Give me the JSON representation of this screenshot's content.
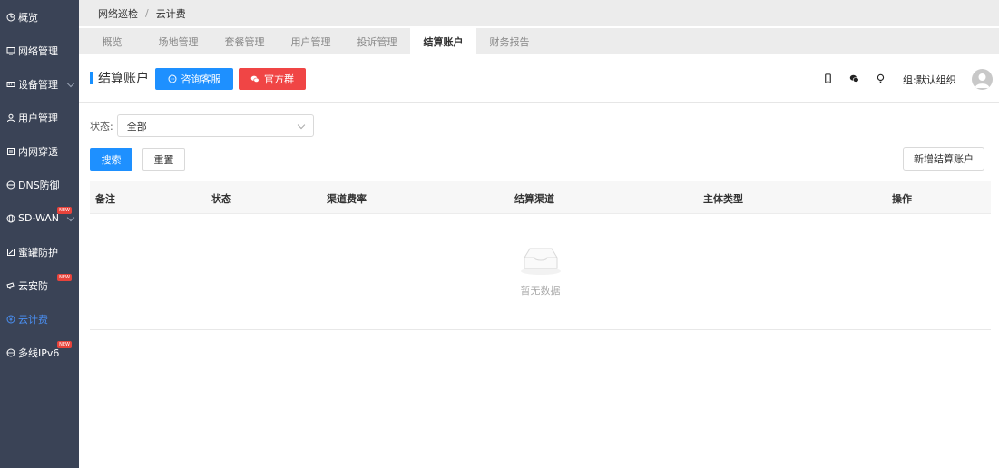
{
  "sidebar": {
    "items": [
      {
        "label": "概览",
        "icon": "dashboard-icon"
      },
      {
        "label": "网络管理",
        "icon": "monitor-icon"
      },
      {
        "label": "设备管理",
        "icon": "device-icon",
        "expandable": true
      },
      {
        "label": "用户管理",
        "icon": "user-icon"
      },
      {
        "label": "内网穿透",
        "icon": "tunnel-icon"
      },
      {
        "label": "DNS防御",
        "icon": "shield-icon"
      },
      {
        "label": "SD-WAN",
        "icon": "globe-icon",
        "expandable": true,
        "badge": "NEW"
      },
      {
        "label": "蜜罐防护",
        "icon": "honeypot-icon"
      },
      {
        "label": "云安防",
        "icon": "camera-icon",
        "badge": "NEW"
      },
      {
        "label": "云计费",
        "icon": "billing-icon",
        "active": true
      },
      {
        "label": "多线IPv6",
        "icon": "globe-icon",
        "badge": "NEW"
      }
    ]
  },
  "breadcrumb": {
    "items": [
      "网络巡检",
      "云计费"
    ],
    "separator": "/"
  },
  "tabs": {
    "items": [
      "概览",
      "场地管理",
      "套餐管理",
      "用户管理",
      "投诉管理",
      "结算账户",
      "财务报告"
    ],
    "active_index": 5
  },
  "header": {
    "title": "结算账户",
    "consult_button": "咨询客服",
    "group_button": "官方群",
    "org_label": "组:默认组织"
  },
  "filter": {
    "status_label": "状态:",
    "status_value": "全部"
  },
  "buttons": {
    "search": "搜索",
    "reset": "重置",
    "add": "新增结算账户"
  },
  "table": {
    "columns": [
      "备注",
      "状态",
      "渠道费率",
      "结算渠道",
      "主体类型",
      "操作"
    ],
    "rows": [],
    "empty_text": "暂无数据"
  },
  "colors": {
    "sidebar_bg": "#3a4356",
    "primary": "#1e90ff",
    "danger": "#f04545",
    "active_nav": "#4a8ff2"
  }
}
